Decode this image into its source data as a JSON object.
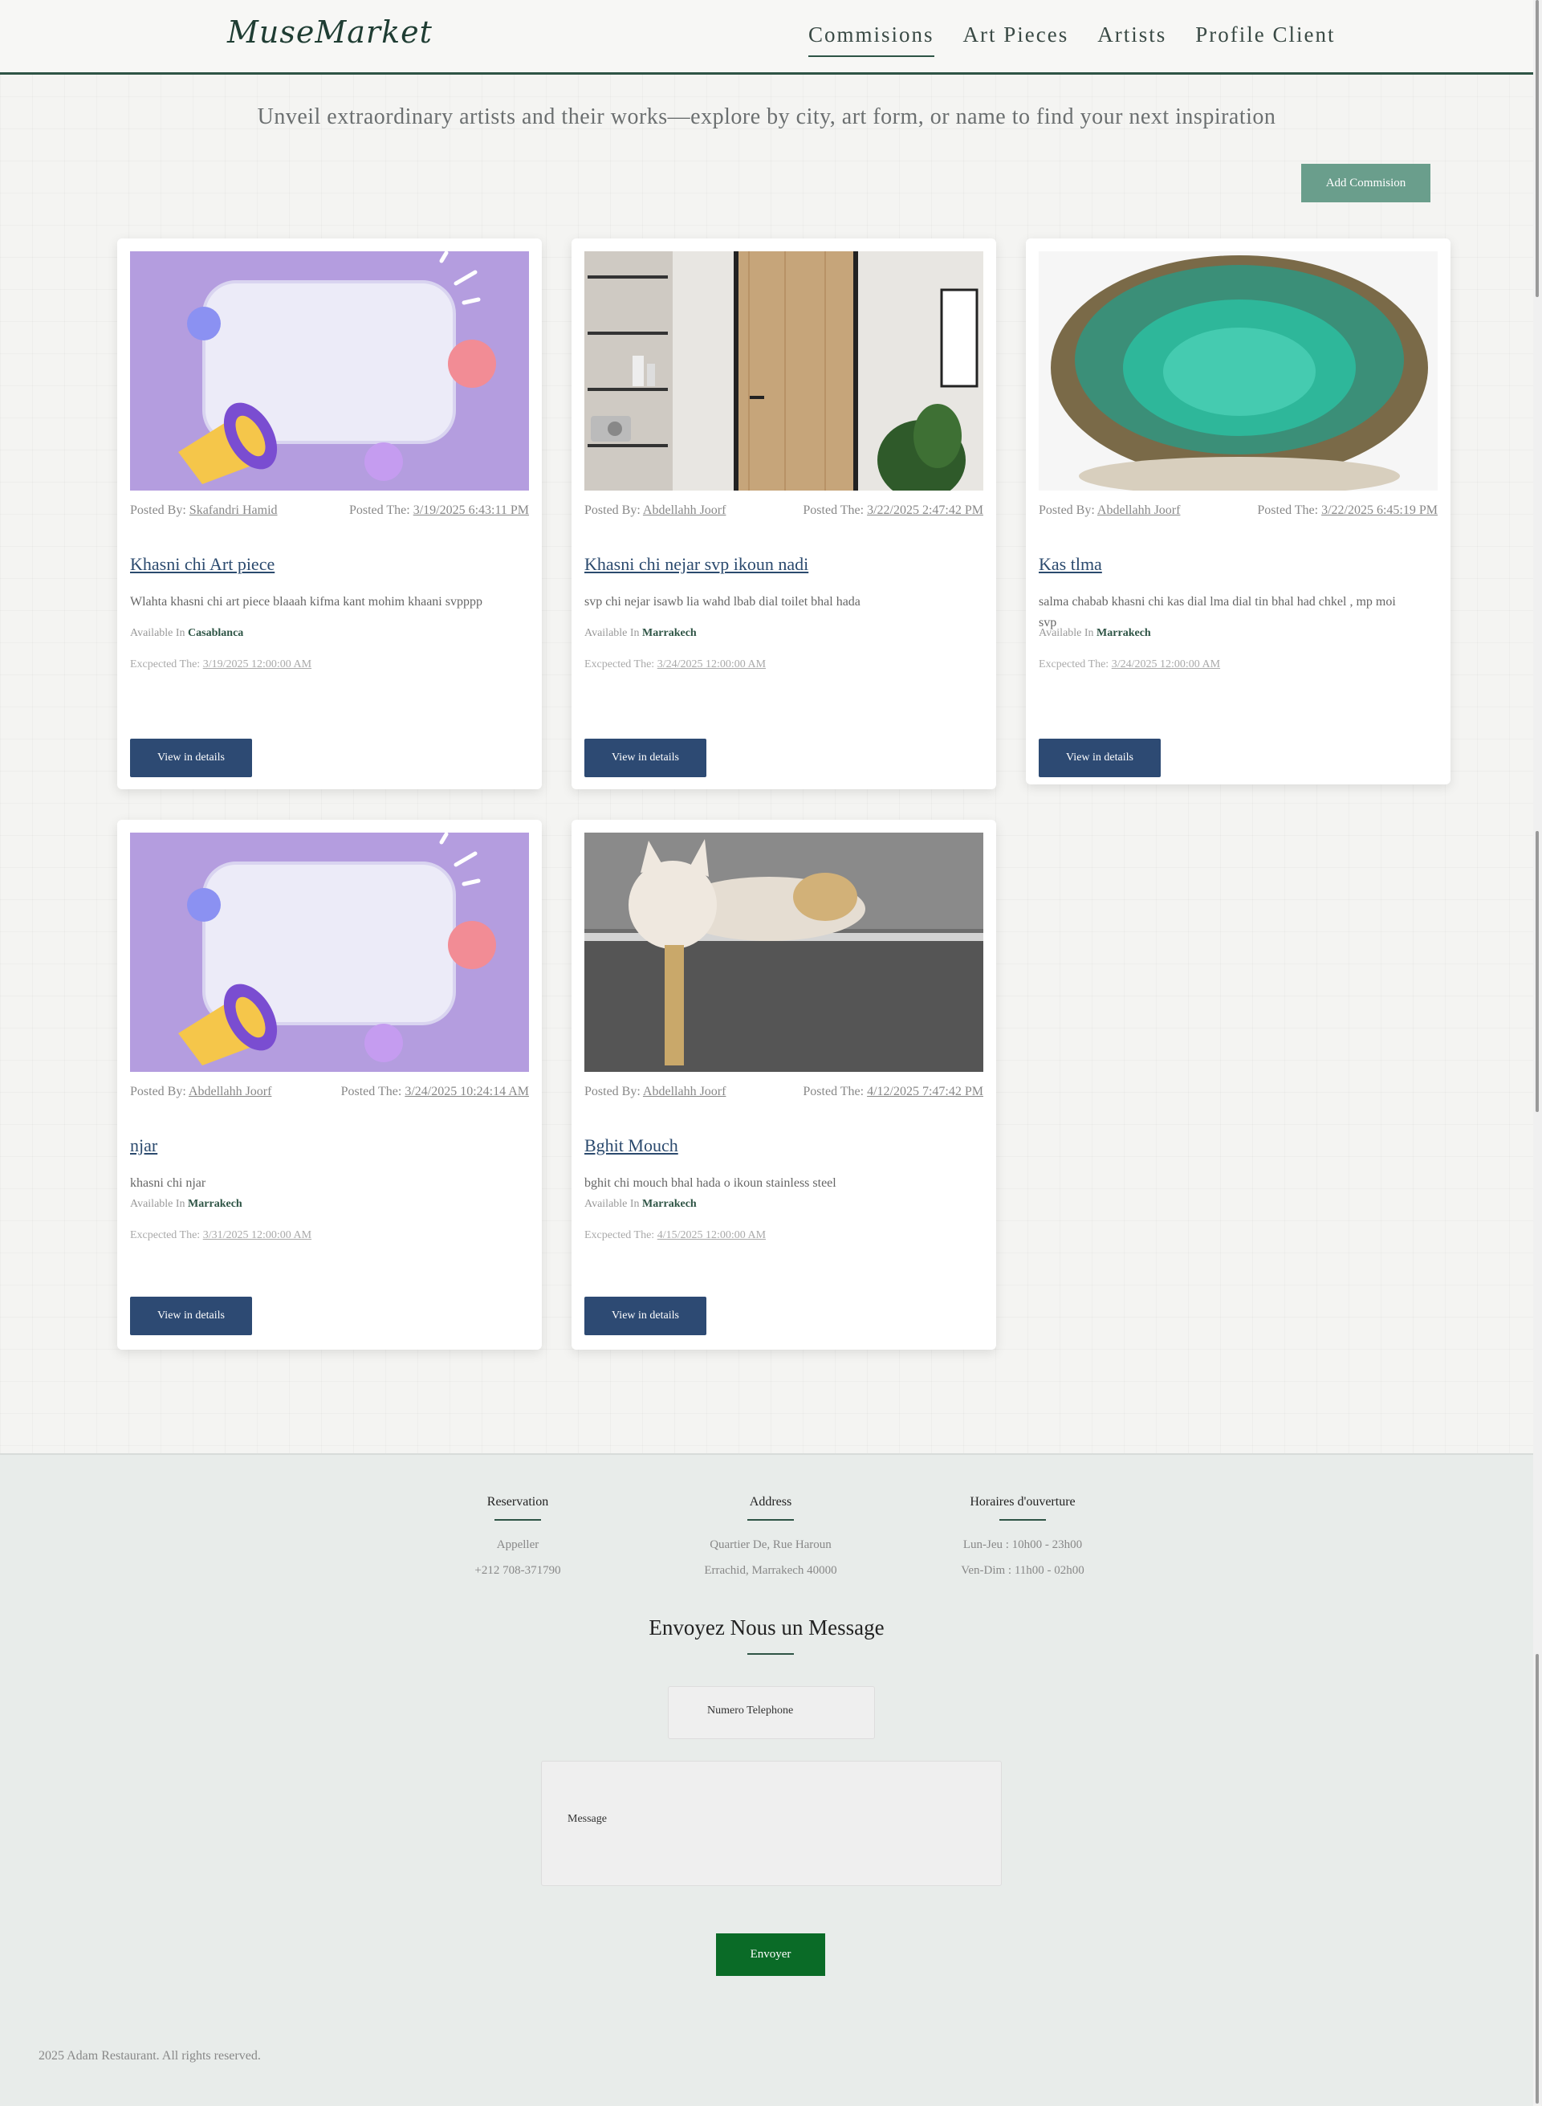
{
  "header": {
    "logo": "MuseMarket",
    "nav": [
      "Commisions",
      "Art Pieces",
      "Artists",
      "Profile Client"
    ]
  },
  "tagline": "Unveil extraordinary artists and their works—explore by city, art form, or name to find your next inspiration",
  "add_button": "Add Commision",
  "labels": {
    "posted_by": "Posted By:",
    "posted_the": "Posted The:",
    "available_in": "Available In",
    "expected": "Excpected The:",
    "view": "View in details"
  },
  "cards": [
    {
      "author": "Skafandri Hamid",
      "date": "3/19/2025 6:43:11 PM",
      "title": "Khasni chi Art piece",
      "desc": "Wlahta khasni chi art piece blaaah kifma kant mohim khaani svpppp",
      "city": "Casablanca",
      "expected": "3/19/2025 12:00:00 AM",
      "image": "megaphone-illustration"
    },
    {
      "author": "Abdellahh Joorf",
      "date": "3/22/2025 2:47:42 PM",
      "title": "Khasni chi nejar svp ikoun nadi",
      "desc": "svp chi nejar isawb lia wahd lbab dial toilet bhal hada",
      "city": "Marrakech",
      "expected": "3/24/2025 12:00:00 AM",
      "image": "wooden-door-photo"
    },
    {
      "author": "Abdellahh Joorf",
      "date": "3/22/2025 6:45:19 PM",
      "title": "Kas tlma",
      "desc": "salma chabab khasni chi kas dial lma dial tin bhal had chkel , mp moi svp",
      "city": "Marrakech",
      "expected": "3/24/2025 12:00:00 AM",
      "image": "ceramic-bowl-photo"
    },
    {
      "author": "Abdellahh Joorf",
      "date": "3/24/2025 10:24:14 AM",
      "title": "njar",
      "desc": "khasni chi njar",
      "city": "Marrakech",
      "expected": "3/31/2025 12:00:00 AM",
      "image": "megaphone-illustration"
    },
    {
      "author": "Abdellahh Joorf",
      "date": "4/12/2025 7:47:42 PM",
      "title": "Bghit Mouch",
      "desc": "bghit chi mouch bhal hada o ikoun stainless steel",
      "city": "Marrakech",
      "expected": "4/15/2025 12:00:00 AM",
      "image": "porcelain-cat-photo"
    }
  ],
  "footer": {
    "cols": [
      {
        "title": "Reservation",
        "lines": [
          "Appeller",
          "+212 708-371790"
        ]
      },
      {
        "title": "Address",
        "lines": [
          "Quartier De, Rue Haroun",
          "Errachid, Marrakech 40000"
        ]
      },
      {
        "title": "Horaires d'ouverture",
        "lines": [
          "Lun-Jeu : 10h00 - 23h00",
          "Ven-Dim : 11h00 - 02h00"
        ]
      }
    ],
    "message_title": "Envoyez Nous un Message",
    "phone_placeholder": "Numero Telephone",
    "message_placeholder": "Message",
    "send": "Envoyer",
    "copyright": "2025 Adam Restaurant. All rights reserved."
  },
  "colors": {
    "accent": "#2e5445",
    "button": "#2d4a73",
    "add": "#6a9e8c",
    "send": "#0a6b27"
  }
}
